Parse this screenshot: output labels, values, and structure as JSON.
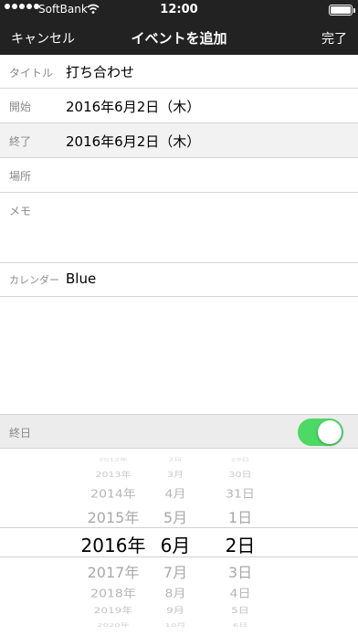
{
  "status_bar": {
    "carrier": "SoftBank",
    "time": "12:00",
    "signal_icon": "signal-dots-icon",
    "wifi_icon": "wifi-icon",
    "battery_icon": "battery-icon",
    "battery_level": 1.0
  },
  "nav": {
    "cancel_label": "キャンセル",
    "title": "イベントを追加",
    "done_label": "完了"
  },
  "form": {
    "title": {
      "label": "タイトル",
      "value": "打ち合わせ"
    },
    "start": {
      "label": "開始",
      "value": "2016年6月2日（木）"
    },
    "end": {
      "label": "終了",
      "value": "2016年6月2日（木）"
    },
    "place": {
      "label": "場所",
      "value": ""
    },
    "memo": {
      "label": "メモ",
      "value": ""
    },
    "calendar": {
      "label": "カレンダー",
      "value": "Blue"
    }
  },
  "all_day": {
    "label": "終日",
    "enabled": true,
    "toggle_color": "#4cd964"
  },
  "picker": {
    "years": [
      "2012年",
      "2013年",
      "2014年",
      "2015年",
      "2016年",
      "2017年",
      "2018年",
      "2019年",
      "2020年"
    ],
    "months": [
      "2月",
      "3月",
      "4月",
      "5月",
      "6月",
      "7月",
      "8月",
      "9月",
      "10月"
    ],
    "days": [
      "29日",
      "30日",
      "31日",
      "1日",
      "2日",
      "3日",
      "4日",
      "5日",
      "6日"
    ],
    "selected": {
      "year": "2016年",
      "month": "6月",
      "day": "2日"
    }
  }
}
